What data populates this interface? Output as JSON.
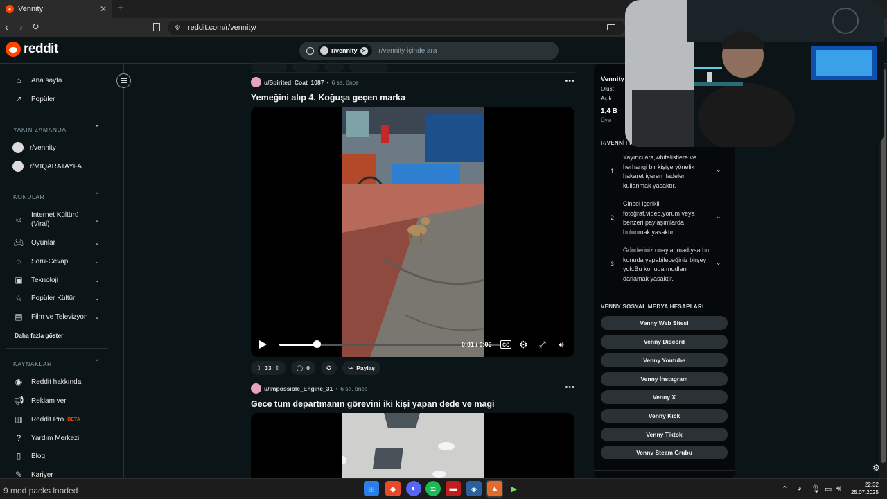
{
  "browser": {
    "tab_title": "Vennity",
    "tab_close": "✕",
    "new_tab": "+",
    "url": "reddit.com/r/vennity/"
  },
  "header": {
    "logo_text": "reddit",
    "search_chip": "r/vennity",
    "search_placeholder": "r/vennity içinde ara"
  },
  "sidebar": {
    "top_items": [
      {
        "label": "Ana sayfa",
        "icon": "home-icon"
      },
      {
        "label": "Popüler",
        "icon": "popular-icon"
      }
    ],
    "recent_title": "YAKIN ZAMANDA",
    "recent": [
      "r/vennity",
      "r/MIQARATAYFA"
    ],
    "topics_title": "KONULAR",
    "topics": [
      {
        "label": "İnternet Kültürü (Viral)",
        "icon": "smile-icon"
      },
      {
        "label": "Oyunlar",
        "icon": "gamepad-icon"
      },
      {
        "label": "Soru-Cevap",
        "icon": "question-icon"
      },
      {
        "label": "Teknoloji",
        "icon": "chip-icon"
      },
      {
        "label": "Popüler Kültür",
        "icon": "star-icon"
      },
      {
        "label": "Film ve Televizyon",
        "icon": "film-icon"
      }
    ],
    "show_more": "Daha fazla göster",
    "resources_title": "KAYNAKLAR",
    "resources": [
      {
        "label": "Reddit hakkında",
        "icon": "reddit-icon"
      },
      {
        "label": "Reklam ver",
        "icon": "megaphone-icon"
      },
      {
        "label": "Reddit Pro",
        "icon": "chart-icon",
        "badge": "BETA"
      },
      {
        "label": "Yardım Merkezi",
        "icon": "help-icon"
      },
      {
        "label": "Blog",
        "icon": "book-icon"
      },
      {
        "label": "Kariyer",
        "icon": "wrench-icon"
      }
    ]
  },
  "posts": [
    {
      "user": "u/Spirited_Coat_1087",
      "age": "6 sa. önce",
      "title": "Yemeğini alıp 4. Koğuşa geçen marka",
      "time": "0:01 / 0:06",
      "progress": 0.17,
      "votes": "33",
      "comments": "0",
      "share": "Paylaş"
    },
    {
      "user": "u/Impossible_Engine_31",
      "age": "6 sa. önce",
      "title": "Gece tüm departmanın görevini iki kişi yapan dede ve magi"
    }
  ],
  "right_sidebar": {
    "name": "Vennity",
    "line1": "Olușt",
    "line2": "Açık",
    "members": "1,4 B",
    "members_label": "Üye",
    "rules_title": "R/VENNİTY KU",
    "rules": [
      {
        "num": "1",
        "text": "Yayıncılara,whitelistlere ve herhangi bir kişiye yönelik hakaret içeren ifadeler kullanmak yasaktır."
      },
      {
        "num": "2",
        "text": "Cinsel içerikli fotoğraf,video,yorum veya benzeri paylaşımlarda bulunmak yasaktır."
      },
      {
        "num": "3",
        "text": "Gönderiniz onaylanmadıysa bu konuda yapabileceğiniz birşey yok.Bu konuda modları darlamak yasaktır."
      }
    ],
    "social_title": "VENNY SOSYAL MEDYA HESAPLARI",
    "social_links": [
      "Venny Web Sitesi",
      "Venny Discord",
      "Venny Youtube",
      "Venny İnstagram",
      "Venny X",
      "Venny Kick",
      "Venny Tiktok",
      "Venny Steam Grubu"
    ]
  },
  "taskbar": {
    "status": "9 mod packs loaded",
    "time": "22:32",
    "date": "25.07.2025"
  },
  "colors": {
    "accent": "#ff4500",
    "background": "#0b1416",
    "surface": "#2a3236"
  }
}
